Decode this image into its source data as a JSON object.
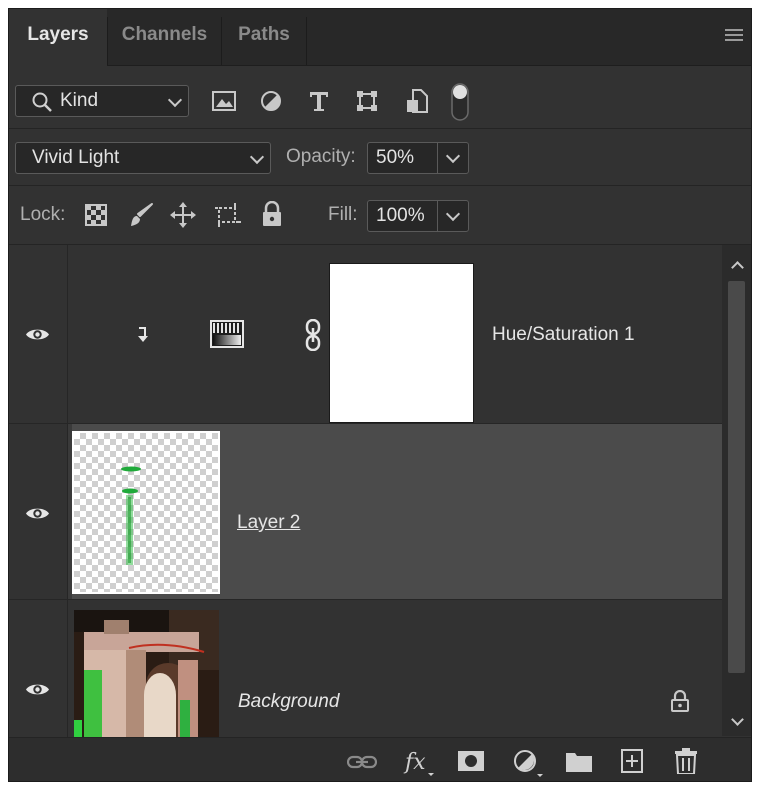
{
  "tabs": [
    {
      "label": "Layers",
      "active": true
    },
    {
      "label": "Channels",
      "active": false
    },
    {
      "label": "Paths",
      "active": false
    }
  ],
  "filter": {
    "kind_label": "Kind",
    "icons": [
      "image-filter-icon",
      "adjustment-filter-icon",
      "type-filter-icon",
      "shape-filter-icon",
      "smart-object-filter-icon",
      "filter-toggle-icon"
    ]
  },
  "blend": {
    "mode": "Vivid Light",
    "opacity_label": "Opacity:",
    "opacity_value": "50%"
  },
  "lock": {
    "label": "Lock:",
    "icons": [
      "lock-transparent-pixels-icon",
      "lock-image-pixels-icon",
      "lock-position-icon",
      "lock-artboard-icon",
      "lock-all-icon"
    ],
    "fill_label": "Fill:",
    "fill_value": "100%"
  },
  "layers": [
    {
      "name": "Hue/Saturation 1",
      "visible": true,
      "clipped": true,
      "selected": false
    },
    {
      "name": "Layer 2",
      "visible": true,
      "selected": true
    },
    {
      "name": "Background",
      "visible": true,
      "locked": true,
      "selected": false
    }
  ],
  "bottom_icons": [
    "link-layers-icon",
    "fx-icon",
    "add-mask-icon",
    "new-adjustment-icon",
    "new-group-icon",
    "new-layer-icon",
    "delete-icon"
  ],
  "colors": {
    "panel_bg": "#323232",
    "selected_row": "#4b4b4b",
    "text": "#e6e6e6"
  }
}
